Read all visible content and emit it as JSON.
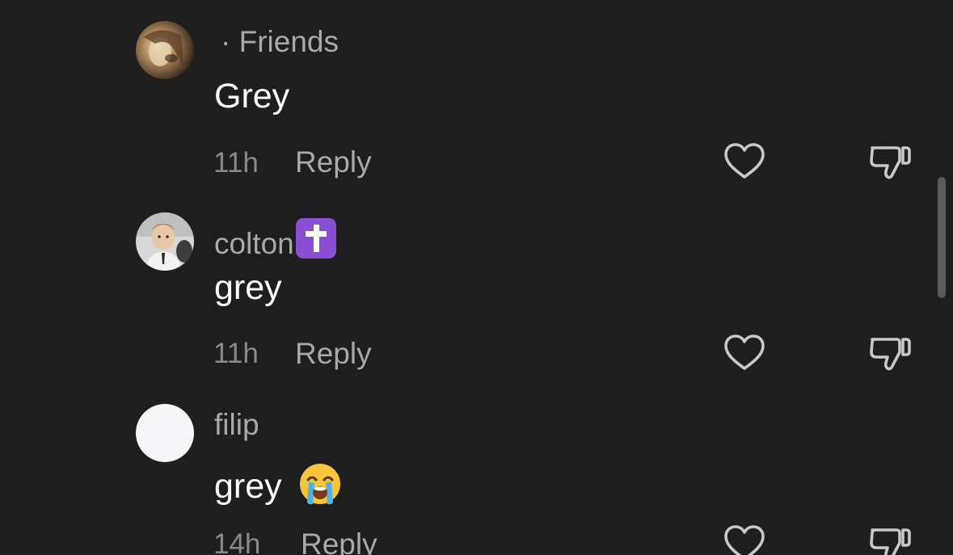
{
  "comments": [
    {
      "author": "· Friends",
      "text": "Grey",
      "time": "11h",
      "reply_label": "Reply",
      "avatar_icon": "user-avatar-dark-hair"
    },
    {
      "author": "colton",
      "author_emoji_icon": "latin-cross-icon",
      "text": "grey",
      "time": "11h",
      "reply_label": "Reply",
      "avatar_icon": "user-avatar-child"
    },
    {
      "author": "filip",
      "text": "grey",
      "text_emoji_icon": "loudly-crying-face-icon",
      "time": "14h",
      "reply_label": "Reply",
      "avatar_icon": "user-avatar-blank"
    }
  ],
  "colors": {
    "background": "#1e1e1e",
    "primary_text": "#ffffff",
    "secondary_text": "#a9a9a9",
    "icon_stroke": "#c8c8c8",
    "badge_purple": "#8b4fd6"
  }
}
